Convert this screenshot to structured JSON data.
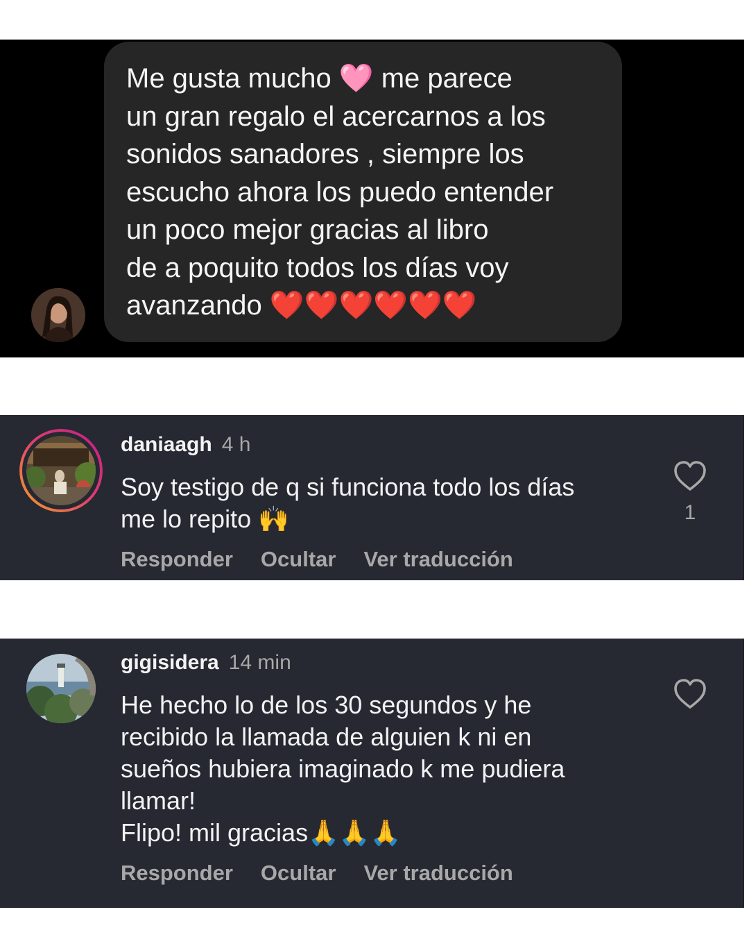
{
  "dm": {
    "lines": [
      "Me gusta mucho 🩷 me parece",
      "un gran regalo el acercarnos a los",
      "sonidos sanadores , siempre los",
      "escucho ahora los puedo entender",
      "un poco mejor gracias al libro",
      "de a poquito todos los días  voy",
      "avanzando ❤️❤️❤️❤️❤️❤️"
    ]
  },
  "comments": [
    {
      "username": "daniaagh",
      "time": "4 h",
      "lines": [
        "Soy testigo de q si funciona todo los días",
        "me lo repito 🙌"
      ],
      "like_count": "1",
      "actions": [
        "Responder",
        "Ocultar",
        "Ver traducción"
      ]
    },
    {
      "username": "gigisidera",
      "time": "14 min",
      "lines": [
        "He hecho lo de los 30 segundos y he",
        "recibido la llamada de alguien k ni en",
        "sueños hubiera imaginado k me pudiera",
        "llamar!",
        "Flipo! mil gracias🙏🙏🙏"
      ],
      "actions": [
        "Responder",
        "Ocultar",
        "Ver traducción"
      ]
    }
  ],
  "icons": {
    "like": "heart-outline-icon"
  },
  "colors": {
    "dm_background": "#000000",
    "dm_bubble": "#262626",
    "comment_background": "#262932",
    "story_ring_start": "#f2a12a",
    "story_ring_end": "#c21d8a",
    "secondary_text": "#a8a8a8"
  }
}
